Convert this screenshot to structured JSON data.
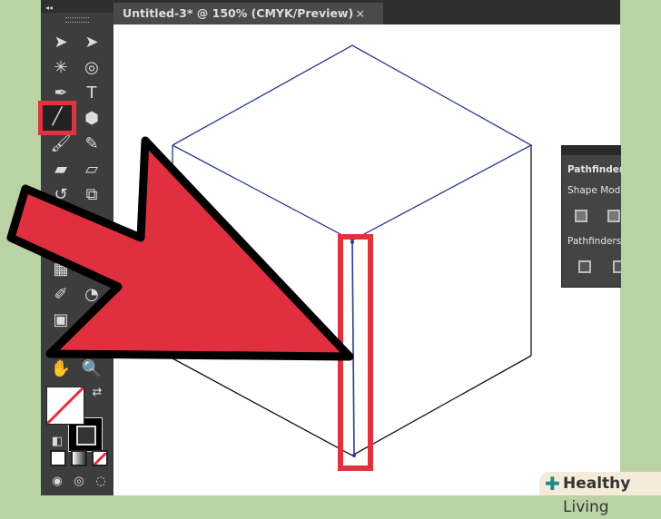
{
  "document_tab": {
    "title": "Untitled-3* @ 150% (CMYK/Preview)",
    "close": "×"
  },
  "toolbar": {
    "collapse": "◂◂",
    "selected_tool": "line-segment-tool",
    "tools": [
      "selection-tool",
      "direct-selection-tool",
      "magic-wand-tool",
      "lasso-tool",
      "pen-tool",
      "type-tool",
      "line-segment-tool",
      "shape-tool",
      "paintbrush-tool",
      "pencil-tool",
      "blob-brush-tool",
      "eraser-tool",
      "rotate-tool",
      "scale-tool",
      "mesh-tool",
      "eyedropper-tool",
      "blend-tool",
      "symbol-sprayer-tool",
      "hand-tool",
      "zoom-tool"
    ]
  },
  "pathfinder": {
    "title": "Pathfinder",
    "shape_modes": "Shape Mode",
    "pathfinders": "Pathfinders"
  },
  "watermark": {
    "bold": "Healthy",
    "regular": " Living"
  },
  "colors": {
    "highlight": "#e0323f",
    "arrow_fill": "#e03040",
    "path_blue": "#2a3a8c",
    "panel": "#3d3d3d"
  }
}
